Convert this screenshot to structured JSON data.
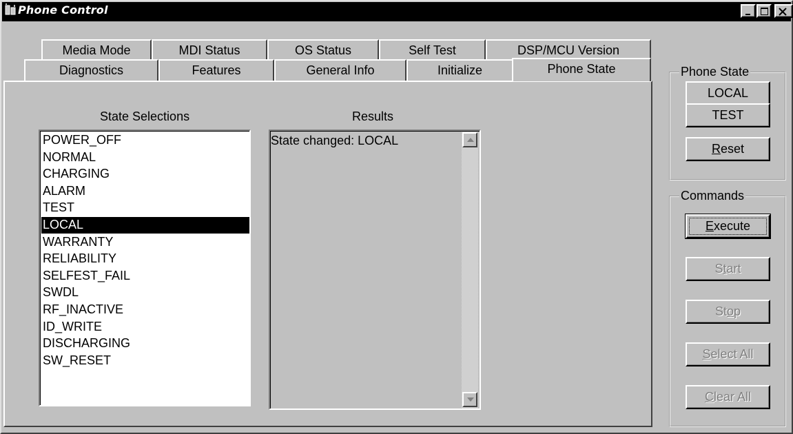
{
  "window": {
    "title": "Phone Control",
    "controls": [
      "minimize-icon",
      "maximize-icon",
      "close-icon"
    ]
  },
  "tabs": {
    "back_row": [
      "Media Mode",
      "MDI Status",
      "OS Status",
      "Self Test",
      "DSP/MCU Version"
    ],
    "front_row": [
      "Diagnostics",
      "Features",
      "General Info",
      "Initialize",
      "Phone State"
    ],
    "active": "Phone State"
  },
  "panel": {
    "state_selections_label": "State Selections",
    "results_label": "Results",
    "state_items": [
      "POWER_OFF",
      "NORMAL",
      "CHARGING",
      "ALARM",
      "TEST",
      "LOCAL",
      "WARRANTY",
      "RELIABILITY",
      "SELFEST_FAIL",
      "SWDL",
      "RF_INACTIVE",
      "ID_WRITE",
      "DISCHARGING",
      "SW_RESET"
    ],
    "selected_item": "LOCAL",
    "results_text": "State changed: LOCAL"
  },
  "phone_state_group": {
    "label": "Phone State",
    "local_button": "LOCAL",
    "test_button": "TEST",
    "reset_button": {
      "mnemonic": "R",
      "rest": "eset"
    }
  },
  "commands_group": {
    "label": "Commands",
    "execute_button": {
      "mnemonic": "E",
      "rest": "xecute"
    },
    "start_button": {
      "before": "S",
      "mnemonic": "t",
      "rest": "art"
    },
    "stop_button": {
      "before": "St",
      "mnemonic": "o",
      "rest": "p"
    },
    "select_all_button": {
      "mnemonic": "S",
      "rest": "elect All"
    },
    "clear_all_button": {
      "mnemonic": "C",
      "rest": "lear All"
    }
  }
}
